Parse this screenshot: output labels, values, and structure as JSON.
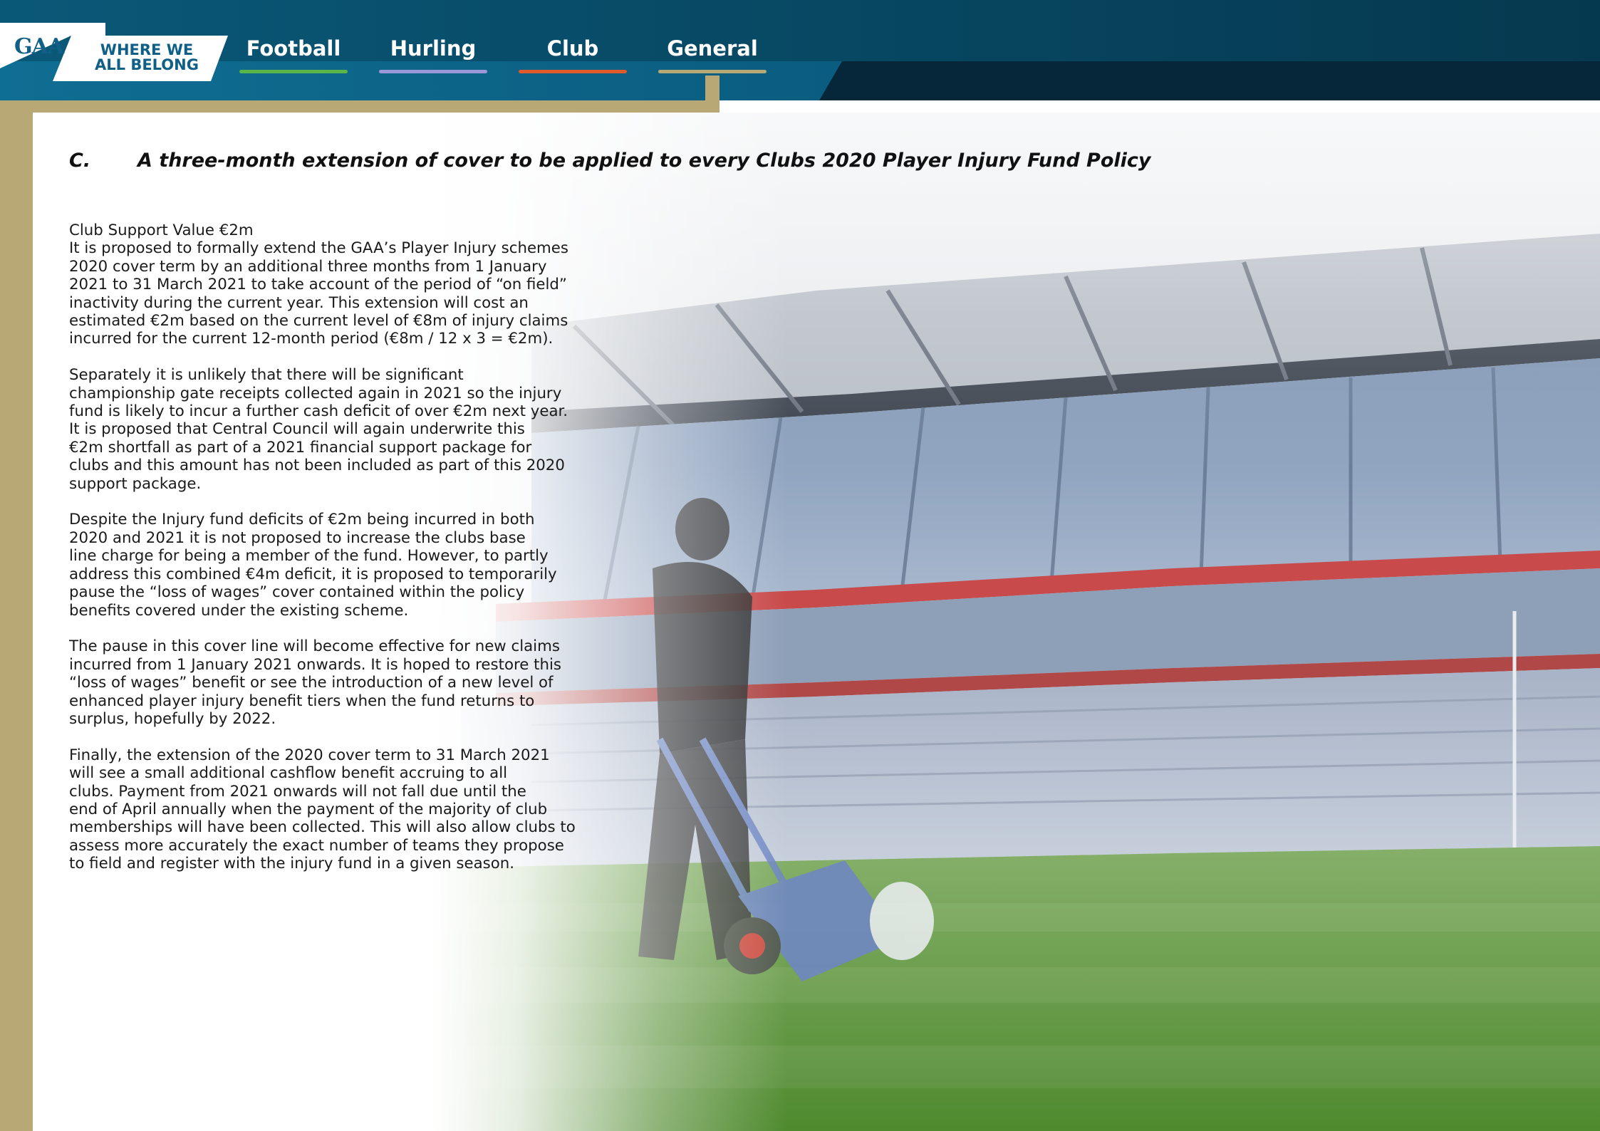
{
  "brand": {
    "logo_text": "GAA",
    "slogan_line1": "WHERE WE",
    "slogan_line2": "ALL BELONG"
  },
  "nav": [
    {
      "label": "Football",
      "color": "#5bb547"
    },
    {
      "label": "Hurling",
      "color": "#9a98d8"
    },
    {
      "label": "Club",
      "color": "#e05a2b"
    },
    {
      "label": "General",
      "color": "#b8a876"
    }
  ],
  "colors": {
    "header_blue": "#0b5f82",
    "header_dark": "#06273a",
    "frame_gold": "#b8a876"
  },
  "section": {
    "letter": "C.",
    "title": "A three-month extension of cover to be applied to every Clubs 2020 Player Injury Fund Policy"
  },
  "content": {
    "support_value": "Club Support Value €2m",
    "paragraphs": [
      "It is proposed to formally extend the GAA’s Player Injury schemes\n2020 cover term by an additional three months from 1 January\n2021 to 31 March 2021 to take account of the period of “on field”\ninactivity during the current year. This extension will cost an\nestimated €2m based on the current level of €8m of injury claims\nincurred for the current 12-month period (€8m / 12 x 3 = €2m).",
      "Separately it is unlikely that there will be significant\nchampionship gate receipts collected again in 2021 so the injury\nfund is likely to incur a further cash deficit of over €2m next year.\nIt is proposed that Central Council will again underwrite this\n€2m shortfall as part of a 2021 financial support package for\nclubs and this amount has not been included as part of this 2020\nsupport package.",
      "Despite the Injury fund deficits of €2m being incurred in both\n2020 and 2021 it is not proposed to increase the clubs base\nline charge for being a member of the fund. However, to partly\naddress this combined €4m deficit, it is proposed to temporarily\npause the “loss of wages” cover contained within the policy\nbenefits covered under the existing scheme.",
      "The pause in this cover line will become effective for new claims\nincurred from 1 January 2021 onwards. It is hoped to restore this\n“loss of wages” benefit or see the introduction of a new level of\nenhanced player injury benefit tiers when the fund returns to\nsurplus, hopefully by 2022.",
      "Finally, the extension of the 2020 cover term to 31 March 2021\nwill see a small additional cashflow benefit accruing to all\nclubs. Payment from 2021 onwards will not fall due until the\nend of April annually when the payment of the majority of club\nmemberships will have been collected. This will also allow clubs to\nassess more accurately the exact number of teams they propose\nto field and register with the injury fund in a given season."
    ]
  }
}
